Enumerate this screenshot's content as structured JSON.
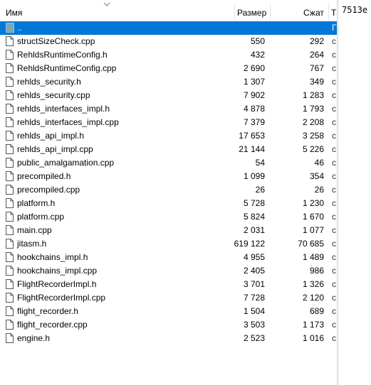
{
  "columns": {
    "name": "Имя",
    "size": "Размер",
    "packed": "Сжат",
    "extra": "Т"
  },
  "up_dir": {
    "label": "..",
    "extra": "Г"
  },
  "files": [
    {
      "name": "structSizeCheck.cpp",
      "size": "550",
      "packed": "292",
      "extra": "c"
    },
    {
      "name": "RehldsRuntimeConfig.h",
      "size": "432",
      "packed": "264",
      "extra": "c"
    },
    {
      "name": "RehldsRuntimeConfig.cpp",
      "size": "2 690",
      "packed": "767",
      "extra": "c"
    },
    {
      "name": "rehlds_security.h",
      "size": "1 307",
      "packed": "349",
      "extra": "c"
    },
    {
      "name": "rehlds_security.cpp",
      "size": "7 902",
      "packed": "1 283",
      "extra": "c"
    },
    {
      "name": "rehlds_interfaces_impl.h",
      "size": "4 878",
      "packed": "1 793",
      "extra": "c"
    },
    {
      "name": "rehlds_interfaces_impl.cpp",
      "size": "7 379",
      "packed": "2 208",
      "extra": "c"
    },
    {
      "name": "rehlds_api_impl.h",
      "size": "17 653",
      "packed": "3 258",
      "extra": "c"
    },
    {
      "name": "rehlds_api_impl.cpp",
      "size": "21 144",
      "packed": "5 226",
      "extra": "c"
    },
    {
      "name": "public_amalgamation.cpp",
      "size": "54",
      "packed": "46",
      "extra": "c"
    },
    {
      "name": "precompiled.h",
      "size": "1 099",
      "packed": "354",
      "extra": "c"
    },
    {
      "name": "precompiled.cpp",
      "size": "26",
      "packed": "26",
      "extra": "c"
    },
    {
      "name": "platform.h",
      "size": "5 728",
      "packed": "1 230",
      "extra": "c"
    },
    {
      "name": "platform.cpp",
      "size": "5 824",
      "packed": "1 670",
      "extra": "c"
    },
    {
      "name": "main.cpp",
      "size": "2 031",
      "packed": "1 077",
      "extra": "c"
    },
    {
      "name": "jitasm.h",
      "size": "619 122",
      "packed": "70 685",
      "extra": "c"
    },
    {
      "name": "hookchains_impl.h",
      "size": "4 955",
      "packed": "1 489",
      "extra": "c"
    },
    {
      "name": "hookchains_impl.cpp",
      "size": "2 405",
      "packed": "986",
      "extra": "c"
    },
    {
      "name": "FlightRecorderImpl.h",
      "size": "3 701",
      "packed": "1 326",
      "extra": "c"
    },
    {
      "name": "FlightRecorderImpl.cpp",
      "size": "7 728",
      "packed": "2 120",
      "extra": "c"
    },
    {
      "name": "flight_recorder.h",
      "size": "1 504",
      "packed": "689",
      "extra": "c"
    },
    {
      "name": "flight_recorder.cpp",
      "size": "3 503",
      "packed": "1 173",
      "extra": "c"
    },
    {
      "name": "engine.h",
      "size": "2 523",
      "packed": "1 016",
      "extra": "c"
    }
  ],
  "right_panel": {
    "text": "7513e"
  },
  "colors": {
    "selection": "#0078d7",
    "header_sep": "#e5e5e5"
  },
  "icons": {
    "file": "file-icon",
    "up": "folder-up-icon",
    "sort": "chevron-down-icon"
  }
}
